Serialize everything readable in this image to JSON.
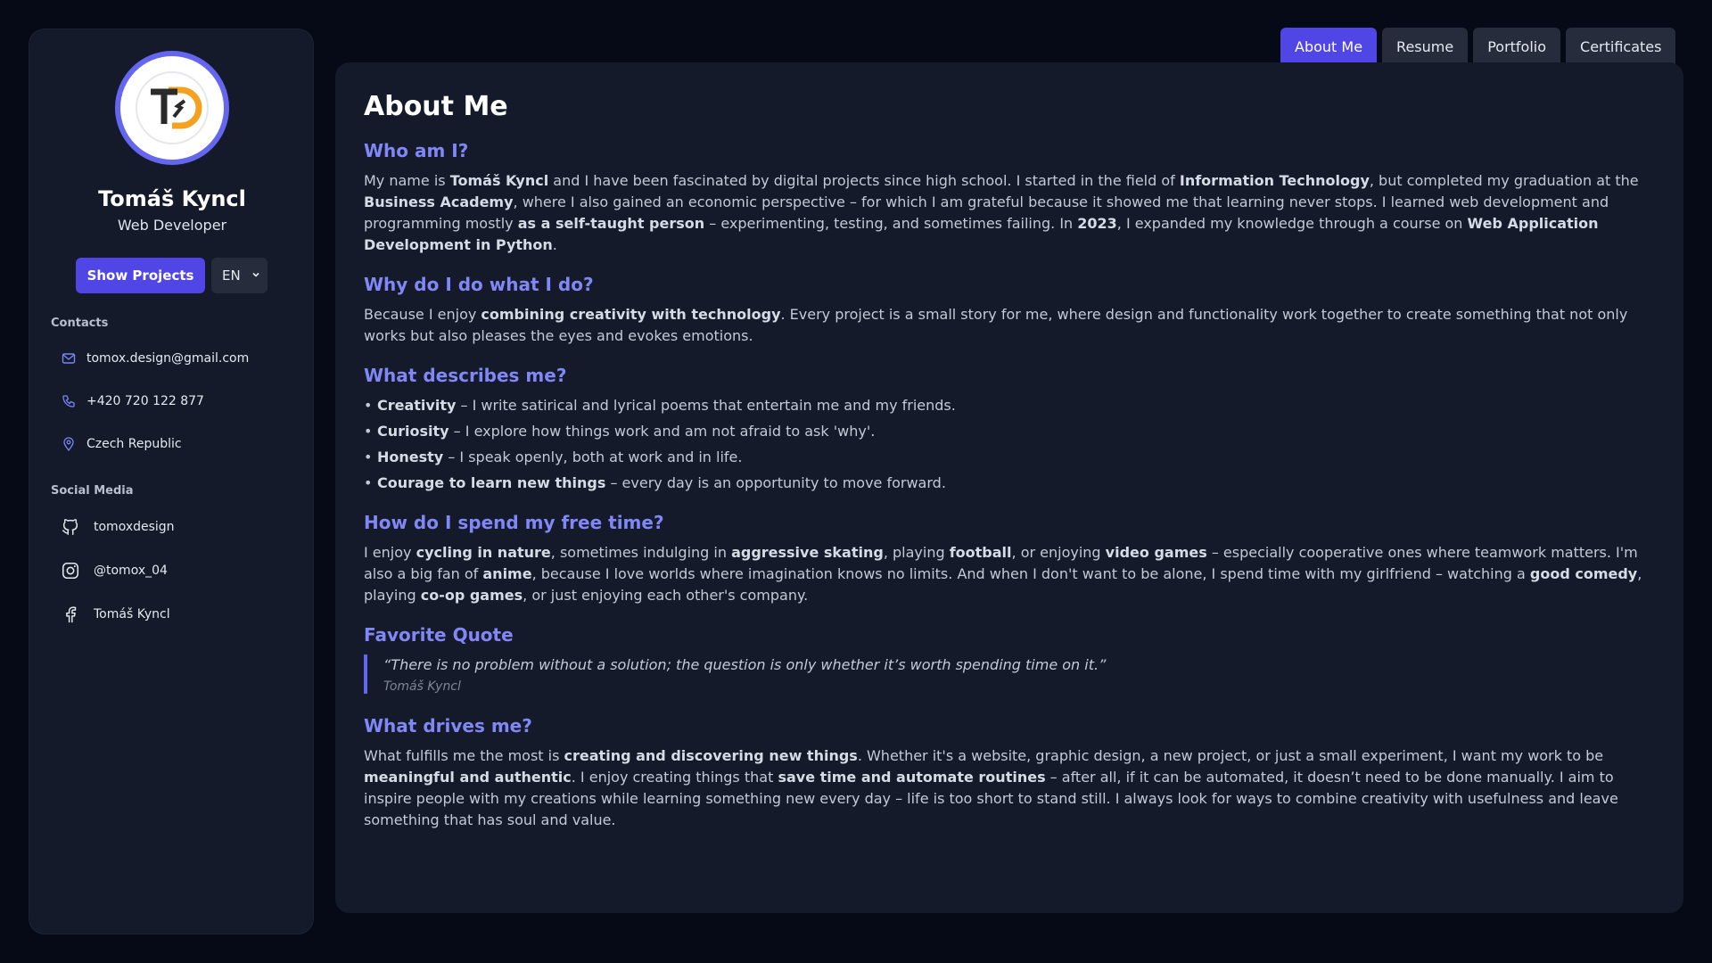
{
  "profile": {
    "name": "Tomáš Kyncl",
    "role": "Web Developer",
    "show_projects": "Show Projects",
    "language": "EN",
    "logo_text": "TD"
  },
  "contacts": {
    "label": "Contacts",
    "email": "tomox.design@gmail.com",
    "phone": "+420 720 122 877",
    "location": "Czech Republic"
  },
  "social": {
    "label": "Social Media",
    "github": "tomoxdesign",
    "instagram": "@tomox_04",
    "facebook": "Tomáš Kyncl"
  },
  "tabs": [
    {
      "label": "About Me",
      "active": true
    },
    {
      "label": "Resume",
      "active": false
    },
    {
      "label": "Portfolio",
      "active": false
    },
    {
      "label": "Certificates",
      "active": false
    }
  ],
  "content": {
    "title": "About Me",
    "who": {
      "heading": "Who am I?",
      "s1": "My name is ",
      "b1": "Tomáš Kyncl",
      "s2": " and I have been fascinated by digital projects since high school. I started in the field of ",
      "b2": "Information Technology",
      "s3": ", but completed my graduation at the ",
      "b3": "Business Academy",
      "s4": ", where I also gained an economic perspective – for which I am grateful because it showed me that learning never stops. I learned web development and programming mostly ",
      "b4": "as a self-taught person",
      "s5": " – experimenting, testing, and sometimes failing. In ",
      "b5": "2023",
      "s6": ", I expanded my knowledge through a course on ",
      "b6": "Web Application Development in Python",
      "s7": "."
    },
    "why": {
      "heading": "Why do I do what I do?",
      "s1": "Because I enjoy ",
      "b1": "combining creativity with technology",
      "s2": ". Every project is a small story for me, where design and functionality work together to create something that not only works but also pleases the eyes and evokes emotions."
    },
    "describes": {
      "heading": "What describes me?",
      "items": [
        {
          "bold": "Creativity",
          "text": " – I write satirical and lyrical poems that entertain me and my friends."
        },
        {
          "bold": "Curiosity",
          "text": " – I explore how things work and am not afraid to ask 'why'."
        },
        {
          "bold": "Honesty",
          "text": " – I speak openly, both at work and in life."
        },
        {
          "bold": "Courage to learn new things",
          "text": " – every day is an opportunity to move forward."
        }
      ]
    },
    "free": {
      "heading": "How do I spend my free time?",
      "s1": "I enjoy ",
      "b1": "cycling in nature",
      "s2": ", sometimes indulging in ",
      "b2": "aggressive skating",
      "s3": ", playing ",
      "b3": "football",
      "s4": ", or enjoying ",
      "b4": "video games",
      "s5": " – especially cooperative ones where teamwork matters. I'm also a big fan of ",
      "b5": "anime",
      "s6": ", because I love worlds where imagination knows no limits. And when I don't want to be alone, I spend time with my girlfriend – watching a ",
      "b6": "good comedy",
      "s7": ", playing ",
      "b7": "co-op games",
      "s8": ", or just enjoying each other's company."
    },
    "quote": {
      "heading": "Favorite Quote",
      "text": "“There is no problem without a solution; the question is only whether it’s worth spending time on it.”",
      "author": "Tomáš Kyncl"
    },
    "drives": {
      "heading": "What drives me?",
      "s1": "What fulfills me the most is ",
      "b1": "creating and discovering new things",
      "s2": ". Whether it's a website, graphic design, a new project, or just a small experiment, I want my work to be ",
      "b2": "meaningful and authentic",
      "s3": ". I enjoy creating things that ",
      "b3": "save time and automate routines",
      "s4": " – after all, if it can be automated, it doesn’t need to be done manually. I aim to inspire people with my creations while learning something new every day – life is too short to stand still. I always look for ways to combine creativity with usefulness and leave something that has soul and value."
    }
  },
  "colors": {
    "accent": "#4f46e5",
    "heading": "#8187f5",
    "background": "#060a16",
    "panel": "#141a2a"
  }
}
